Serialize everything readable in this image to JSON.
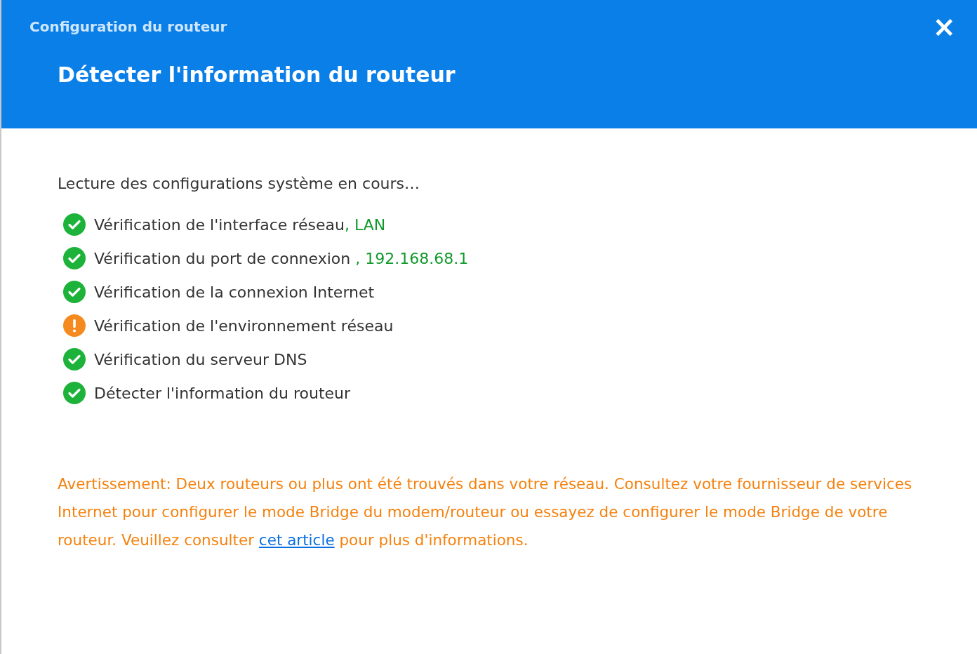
{
  "window": {
    "title": "Configuration du routeur",
    "close": "×"
  },
  "header": {
    "title": "Détecter l'information du routeur"
  },
  "intro": "Lecture des configurations système en cours…",
  "checks": [
    {
      "kind": "ok",
      "text": "Vérification de l'interface réseau",
      "detail": ", LAN"
    },
    {
      "kind": "ok",
      "text": "Vérification du port de connexion ",
      "detail": ", 192.168.68.1"
    },
    {
      "kind": "ok",
      "text": "Vérification de la connexion Internet"
    },
    {
      "kind": "warning",
      "text": "Vérification de l'environnement réseau"
    },
    {
      "kind": "ok",
      "text": "Vérification du serveur DNS"
    },
    {
      "kind": "ok",
      "text": "Détecter l'information du routeur"
    }
  ],
  "warning": {
    "before": "Avertissement: Deux routeurs ou plus ont été trouvés dans votre réseau. Consultez votre fournisseur de services Internet pour configurer le mode Bridge du modem/routeur ou essayez de configurer le mode Bridge de votre routeur. Veuillez consulter ",
    "link": "cet article",
    "after": " pour plus d'informations."
  }
}
